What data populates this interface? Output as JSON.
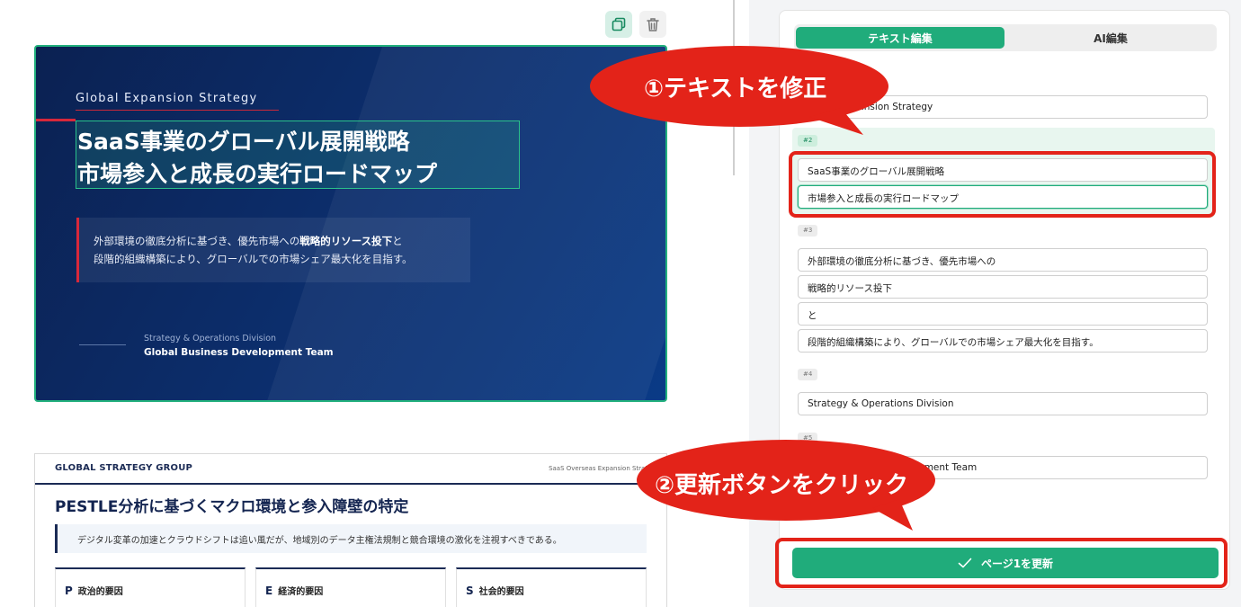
{
  "toolbar": {
    "copy_icon": "copy-icon",
    "trash_icon": "trash-icon"
  },
  "slide1": {
    "subtitle": "Global Expansion Strategy",
    "title_line1": "SaaS事業のグローバル展開戦略",
    "title_line2": "市場参入と成長の実行ロードマップ",
    "body_part1": "外部環境の徹底分析に基づき、優先市場への",
    "body_bold": "戦略的リソース投下",
    "body_part2": "と",
    "body_line2": "段階的組織構築により、グローバルでの市場シェア最大化を目指す。",
    "division": "Strategy & Operations Division",
    "team": "Global Business Development Team"
  },
  "slide2": {
    "brand": "GLOBAL STRATEGY GROUP",
    "right_label": "SaaS Overseas Expansion Strategy",
    "title": "PESTLE分析に基づくマクロ環境と参入障壁の特定",
    "note": "デジタル変革の加速とクラウドシフトは追い風だが、地域別のデータ主権法規制と競合環境の激化を注視すべきである。",
    "cards": [
      {
        "key": "P",
        "label": "政治的要因"
      },
      {
        "key": "E",
        "label": "経済的要因"
      },
      {
        "key": "S",
        "label": "社会的要因"
      }
    ]
  },
  "panel": {
    "tab_text": "テキスト編集",
    "tab_ai": "AI編集",
    "field1": "Global Expansion Strategy",
    "badge2": "#2",
    "field2a": "SaaS事業のグローバル展開戦略",
    "field2b": "市場参入と成長の実行ロードマップ",
    "badge3": "#3",
    "field3a": "外部環境の徹底分析に基づき、優先市場への",
    "field3b": "戦略的リソース投下",
    "field3c": "と",
    "field3d": "段階的組織構築により、グローバルでの市場シェア最大化を目指す。",
    "badge4": "#4",
    "field4": "Strategy & Operations Division",
    "badge5": "#5",
    "field5": "Global Business Development Team",
    "update_button": "ページ1を更新",
    "check_icon": "check-icon"
  },
  "annotations": {
    "callout1": "①テキストを修正",
    "callout2": "②更新ボタンをクリック",
    "color": "#e32319"
  }
}
